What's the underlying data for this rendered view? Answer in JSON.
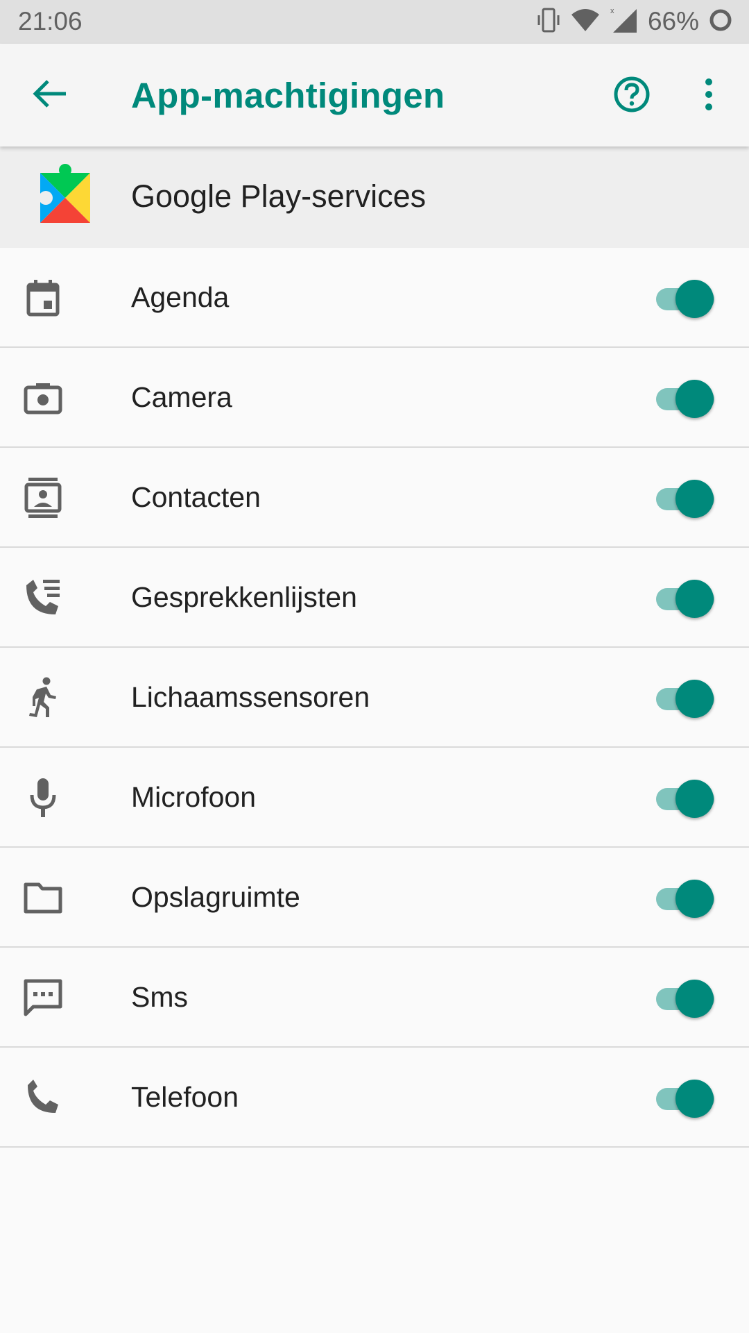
{
  "status_bar": {
    "time": "21:06",
    "battery_percent": "66%",
    "icons": [
      "vibrate-icon",
      "wifi-icon",
      "signal-icon",
      "battery-icon"
    ]
  },
  "app_bar": {
    "title": "App-machtigingen",
    "back_icon": "arrow-back-icon",
    "help_icon": "help-circle-icon",
    "more_icon": "more-vert-icon"
  },
  "app": {
    "name": "Google Play-services",
    "icon": "google-play-services-icon"
  },
  "permissions": [
    {
      "label": "Agenda",
      "icon": "calendar-icon",
      "enabled": true
    },
    {
      "label": "Camera",
      "icon": "camera-icon",
      "enabled": true
    },
    {
      "label": "Contacten",
      "icon": "contacts-icon",
      "enabled": true
    },
    {
      "label": "Gesprekkenlijsten",
      "icon": "call-log-icon",
      "enabled": true
    },
    {
      "label": "Lichaamssensoren",
      "icon": "running-person-icon",
      "enabled": true
    },
    {
      "label": "Microfoon",
      "icon": "microphone-icon",
      "enabled": true
    },
    {
      "label": "Opslagruimte",
      "icon": "folder-icon",
      "enabled": true
    },
    {
      "label": "Sms",
      "icon": "sms-icon",
      "enabled": true
    },
    {
      "label": "Telefoon",
      "icon": "phone-icon",
      "enabled": true
    }
  ],
  "colors": {
    "accent": "#00897b",
    "toggle_track": "#80c4bd",
    "icon_grey": "#616161"
  }
}
